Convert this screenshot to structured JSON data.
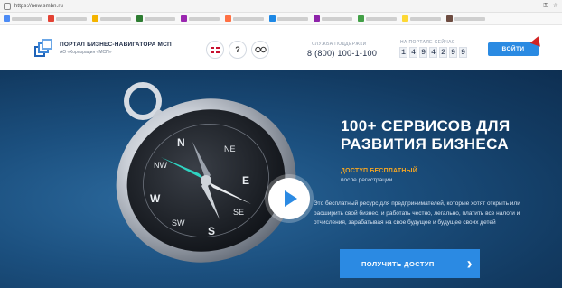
{
  "browser": {
    "url": "https://new.smbn.ru"
  },
  "header": {
    "portal_title": "ПОРТАЛ БИЗНЕС-НАВИГАТОРА МСП",
    "portal_subtitle": "АО «Корпорация «МСП»",
    "support_label": "СЛУЖБА ПОДДЕРЖКИ",
    "support_phone": "8 (800) 100-1-100",
    "counter_label": "НА ПОРТАЛЕ СЕЙЧАС",
    "counter_digits": [
      "1",
      "4",
      "9",
      "4",
      "2",
      "9",
      "9"
    ],
    "login_label": "ВОЙТИ"
  },
  "hero": {
    "title_line1": "100+ СЕРВИСОВ ДЛЯ",
    "title_line2": "РАЗВИТИЯ БИЗНЕСА",
    "access_label": "ДОСТУП БЕСПЛАТНЫЙ",
    "after_label": "после регистрации",
    "description": "Это бесплатный ресурс для предпринимателей, которые хотят открыть или расширить свой бизнес, и работать честно, легально, платить все налоги и отчисления, зарабатывая на свое будущее и будущее своих детей",
    "cta_label": "ПОЛУЧИТЬ ДОСТУП",
    "compass_labels": [
      "N",
      "NE",
      "E",
      "SE",
      "S",
      "SW",
      "W",
      "NW"
    ]
  },
  "colors": {
    "accent": "#2b8ae3",
    "highlight": "#f5a623",
    "hero_bg": "#1b4f7e"
  },
  "icons": {
    "language": "uk-flag-icon",
    "help": "question-icon",
    "accessibility": "glasses-icon",
    "play": "play-icon",
    "arrow": "chevron-right-icon"
  }
}
